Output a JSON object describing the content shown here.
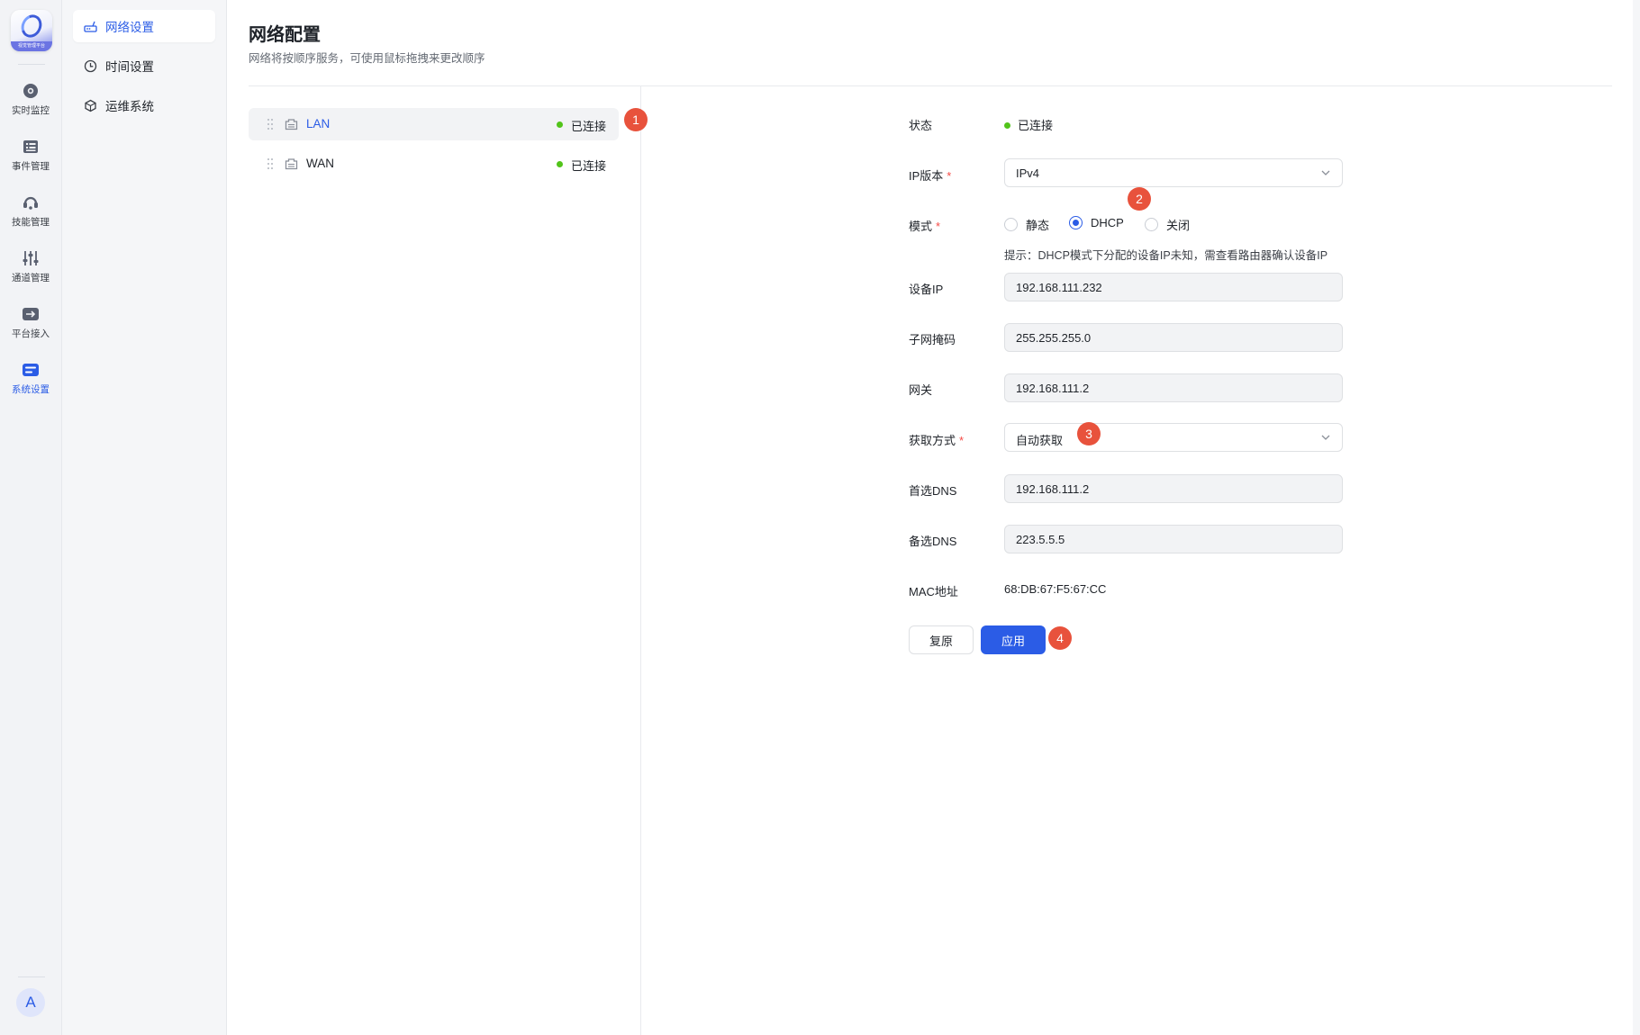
{
  "app": {
    "logo_band_text": "视觉管理平台",
    "avatar_initial": "A"
  },
  "rail": {
    "items": [
      {
        "label": "实时监控",
        "icon": "monitor-icon"
      },
      {
        "label": "事件管理",
        "icon": "event-list-icon"
      },
      {
        "label": "技能管理",
        "icon": "skill-icon"
      },
      {
        "label": "通道管理",
        "icon": "channel-sliders-icon"
      },
      {
        "label": "平台接入",
        "icon": "platform-access-icon"
      },
      {
        "label": "系统设置",
        "icon": "system-settings-icon",
        "active": true
      }
    ]
  },
  "submenu": {
    "items": [
      {
        "label": "网络设置",
        "icon": "router-icon",
        "active": true
      },
      {
        "label": "时间设置",
        "icon": "clock-icon"
      },
      {
        "label": "运维系统",
        "icon": "box-icon"
      }
    ]
  },
  "page": {
    "title": "网络配置",
    "description": "网络将按顺序服务，可使用鼠标拖拽来更改顺序"
  },
  "networks": [
    {
      "name": "LAN",
      "status": "已连接",
      "active": true
    },
    {
      "name": "WAN",
      "status": "已连接"
    }
  ],
  "form": {
    "status_label": "状态",
    "status_value": "已连接",
    "ip_version_label": "IP版本",
    "ip_version_value": "IPv4",
    "mode_label": "模式",
    "mode_options": [
      "静态",
      "DHCP",
      "关闭"
    ],
    "mode_selected": "DHCP",
    "hint": "提示：DHCP模式下分配的设备IP未知，需查看路由器确认设备IP",
    "device_ip_label": "设备IP",
    "device_ip_value": "192.168.111.232",
    "subnet_label": "子网掩码",
    "subnet_value": "255.255.255.0",
    "gateway_label": "网关",
    "gateway_value": "192.168.111.2",
    "acquire_label": "获取方式",
    "acquire_value": "自动获取",
    "dns1_label": "首选DNS",
    "dns1_value": "192.168.111.2",
    "dns2_label": "备选DNS",
    "dns2_value": "223.5.5.5",
    "mac_label": "MAC地址",
    "mac_value": "68:DB:67:F5:67:CC",
    "reset_label": "复原",
    "apply_label": "应用",
    "required_mark": "*"
  },
  "badges": [
    "1",
    "2",
    "3",
    "4"
  ],
  "colors": {
    "accent": "#2b5ce6",
    "badge": "#e8523c",
    "connected": "#52c41a",
    "required": "#f54a45"
  }
}
